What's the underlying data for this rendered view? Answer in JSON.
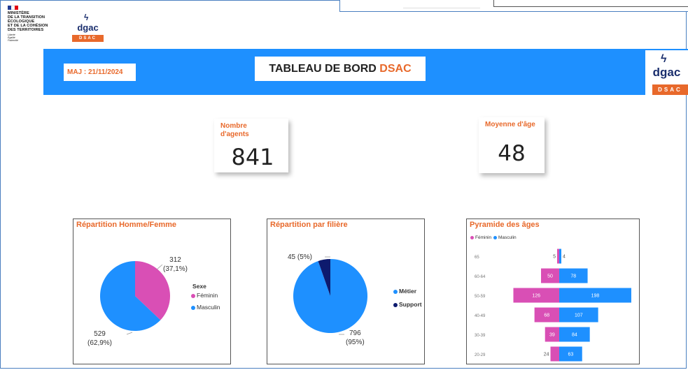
{
  "header": {
    "ministry_lines": "MINISTÈRE\nDE LA TRANSITION\nÉCOLOGIQUE\nET DE LA COHÉSION\nDES TERRITOIRES",
    "ministry_motto": "Liberté\nÉgalité\nFraternité",
    "logo_word": "dgac",
    "logo_band": "DSAC"
  },
  "banner": {
    "maj_label": "MAJ : 21/11/2024",
    "title_main": "TABLEAU DE BORD ",
    "title_accent": "DSAC"
  },
  "kpis": {
    "agents_label": "Nombre\nd'agents",
    "agents_value": "841",
    "age_label": "Moyenne d'âge",
    "age_value": "48"
  },
  "colors": {
    "banner_blue": "#1e90ff",
    "accent_orange": "#e8692b",
    "feminin_pink": "#d94fb5",
    "masculin_blue": "#1e90ff",
    "support_navy": "#0d1a6e"
  },
  "chart_data": [
    {
      "type": "pie",
      "title": "Répartition Homme/Femme",
      "legend_title": "Sexe",
      "legend_placement": "right",
      "slices": [
        {
          "name": "Féminin",
          "value": 312,
          "pct": 37.1,
          "label": "312\n(37,1%)"
        },
        {
          "name": "Masculin",
          "value": 529,
          "pct": 62.9,
          "label": "529\n(62,9%)"
        }
      ]
    },
    {
      "type": "pie",
      "title": "Répartition par filière",
      "legend_placement": "right",
      "slices": [
        {
          "name": "Métier",
          "value": 796,
          "pct": 95,
          "label": "796\n(95%)"
        },
        {
          "name": "Support",
          "value": 45,
          "pct": 5,
          "label": "45 (5%)"
        }
      ]
    },
    {
      "type": "bar",
      "orientation": "horizontal-pyramid",
      "title": "Pyramide des âges",
      "legend_placement": "top-left",
      "categories": [
        "65",
        "60-64",
        "50-59",
        "40-49",
        "30-39",
        "20-29"
      ],
      "series": [
        {
          "name": "Féminin",
          "values": [
            5,
            50,
            126,
            68,
            39,
            24
          ]
        },
        {
          "name": "Masculin",
          "values": [
            4,
            78,
            198,
            107,
            84,
            63
          ]
        }
      ]
    }
  ]
}
